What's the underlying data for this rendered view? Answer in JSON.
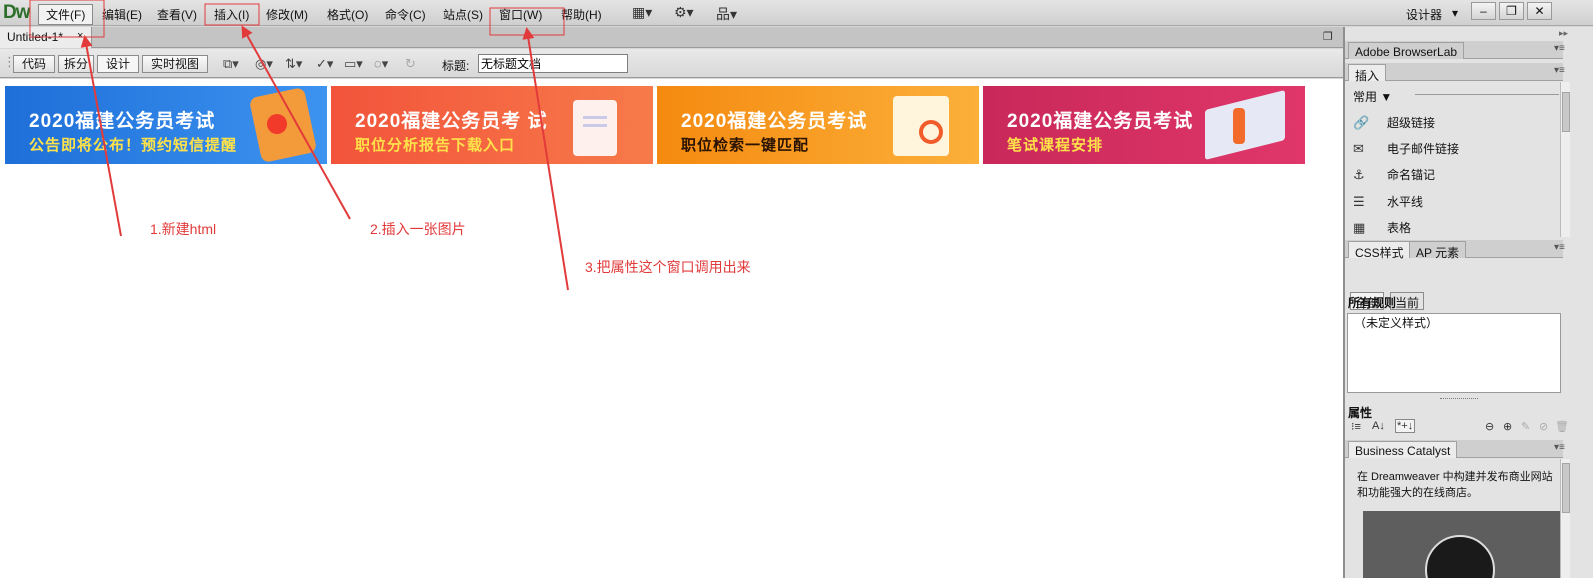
{
  "app": {
    "logo": "Dw",
    "workspace_label": "设计器",
    "workspace_arrow": "▾",
    "window_controls": [
      "–",
      "❐",
      "✕"
    ]
  },
  "menu": [
    {
      "label": "文件(F)"
    },
    {
      "label": "编辑(E)"
    },
    {
      "label": "查看(V)"
    },
    {
      "label": "插入(I)"
    },
    {
      "label": "修改(M)"
    },
    {
      "label": "格式(O)"
    },
    {
      "label": "命令(C)"
    },
    {
      "label": "站点(S)"
    },
    {
      "label": "窗口(W)"
    },
    {
      "label": "帮助(H)"
    }
  ],
  "menu_icons": [
    "layout-icon",
    "gear-icon",
    "site-icon"
  ],
  "document": {
    "tab_title": "Untitled-1*",
    "tab_close": "×"
  },
  "view_toolbar": {
    "buttons": [
      "代码",
      "拆分",
      "设计",
      "实时视图"
    ],
    "title_label": "标题:",
    "title_value": "无标题文档"
  },
  "banners": [
    {
      "line1": "2020福建公务员考试",
      "line2": "公告即将公布！预约短信提醒",
      "line2_color": "#ffe24a",
      "bg": "#2f7fe0"
    },
    {
      "line1": "2020福建公务员考 试",
      "line2": "职位分析报告下载入口",
      "line2_color": "#ffe24a",
      "bg": "#f2543b"
    },
    {
      "line1": "2020福建公务员考试",
      "line2": "职位检索一键匹配",
      "line2_color": "#2a1300",
      "bg": "#f58a10"
    },
    {
      "line1": "2020福建公务员考试",
      "line2": "笔试课程安排",
      "line2_color": "#ffe24a",
      "bg": "#d6305f"
    }
  ],
  "annotations": [
    {
      "text": "1.新建html"
    },
    {
      "text": "2.插入一张图片"
    },
    {
      "text": "3.把属性这个窗口调用出来"
    }
  ],
  "annotation_color": "#e23a3a",
  "panels": {
    "browserlab_title": "Adobe BrowserLab",
    "insert_title": "插入",
    "insert_category": "常用",
    "insert_items": [
      {
        "label": "超级链接",
        "icon": "hyperlink-icon"
      },
      {
        "label": "电子邮件链接",
        "icon": "email-link-icon"
      },
      {
        "label": "命名锚记",
        "icon": "anchor-icon"
      },
      {
        "label": "水平线",
        "icon": "horizontal-rule-icon"
      },
      {
        "label": "表格",
        "icon": "table-icon"
      }
    ],
    "css_tab": "CSS样式",
    "ap_tab": "AP 元素",
    "css_all": "全部",
    "css_current": "当前",
    "all_rules": "所有规则",
    "no_style": "（未定义样式）",
    "properties": "属性",
    "bc_title": "Business Catalyst",
    "bc_text_1": "在 Dreamweaver 中构建并发布商业网站",
    "bc_text_2": "和功能强大的在线商店。"
  }
}
